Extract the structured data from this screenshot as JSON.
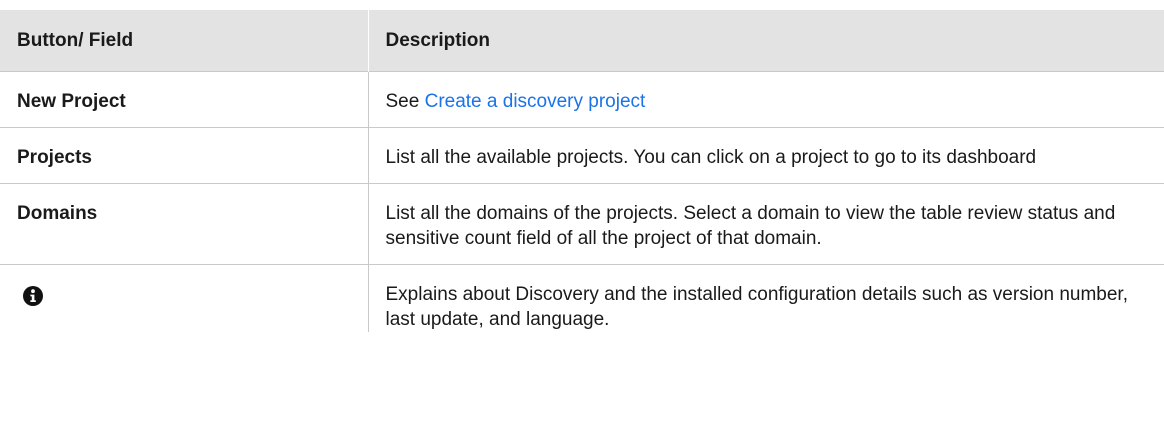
{
  "table": {
    "headers": {
      "field": "Button/ Field",
      "description": "Description"
    },
    "rows": [
      {
        "field": "New Project",
        "description_prefix": "See ",
        "description_link": "Create a discovery project"
      },
      {
        "field": "Projects",
        "description": "List all the available projects. You can click on a project to go to its dashboard"
      },
      {
        "field": "Domains",
        "description": "List all the domains of the projects. Select a domain to view the table review status and sensitive count field of all the project of that domain."
      },
      {
        "field_icon": "info-circle-icon",
        "description": "Explains about Discovery and the installed configuration details such as version number, last update, and language."
      }
    ]
  },
  "colors": {
    "header_bg": "#e3e3e3",
    "link": "#1a73e8",
    "border": "#c9c9c9"
  }
}
